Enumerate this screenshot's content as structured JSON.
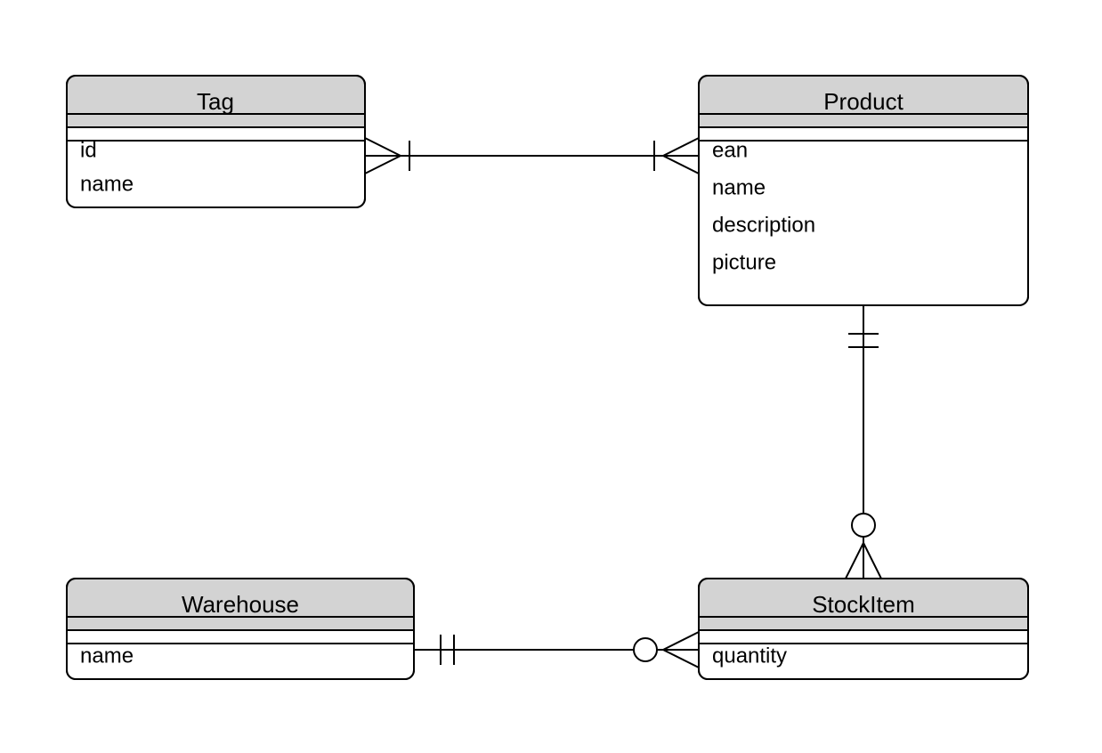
{
  "entities": {
    "tag": {
      "title": "Tag",
      "attributes": [
        "id",
        "name"
      ]
    },
    "product": {
      "title": "Product",
      "attributes": [
        "ean",
        "name",
        "description",
        "picture"
      ]
    },
    "warehouse": {
      "title": "Warehouse",
      "attributes": [
        "name"
      ]
    },
    "stockitem": {
      "title": "StockItem",
      "attributes": [
        "quantity"
      ]
    }
  },
  "relationships": [
    {
      "from": "tag",
      "to": "product",
      "from_card": "many-one",
      "to_card": "many-one"
    },
    {
      "from": "product",
      "to": "stockitem",
      "from_card": "one-one",
      "to_card": "zero-many"
    },
    {
      "from": "warehouse",
      "to": "stockitem",
      "from_card": "one-one",
      "to_card": "zero-many"
    }
  ]
}
